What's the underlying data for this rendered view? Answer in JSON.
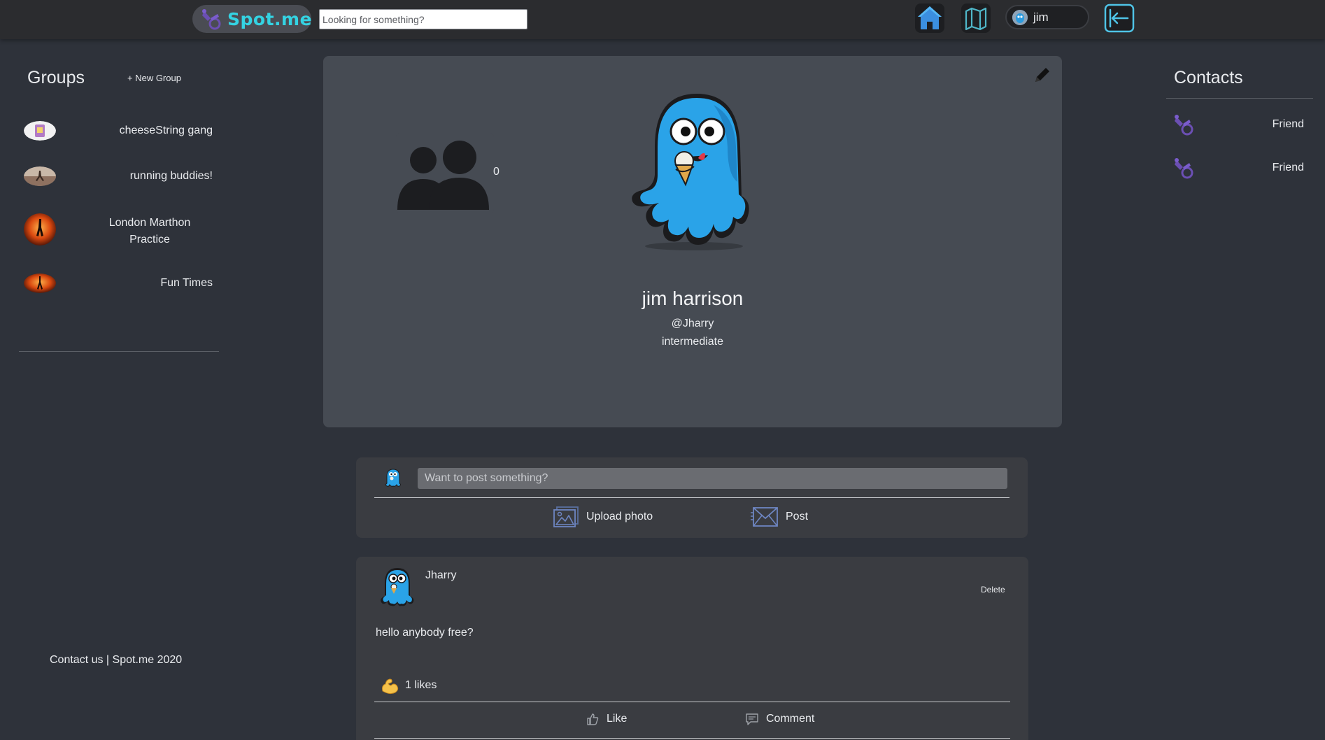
{
  "header": {
    "brand_name": "Spot.me",
    "search_placeholder": "Looking for something?",
    "user_name": "jim",
    "icons": [
      "home-icon",
      "map-icon",
      "logout-icon"
    ],
    "accent_color": "#34d3e3"
  },
  "groups": {
    "title": "Groups",
    "new_group_label": "+ New Group",
    "items": [
      {
        "label": "cheeseString gang"
      },
      {
        "label": "running buddies!"
      },
      {
        "label": "London Marthon Practice"
      },
      {
        "label": "Fun Times"
      }
    ]
  },
  "footer": {
    "text": "Contact us | Spot.me 2020"
  },
  "profile": {
    "followers_count": "0",
    "name": "jim harrison",
    "handle": "@Jharry",
    "level": "intermediate"
  },
  "composer": {
    "placeholder": "Want to post something?",
    "upload_label": "Upload photo",
    "post_label": "Post"
  },
  "post": {
    "author": "Jharry",
    "delete_label": "Delete",
    "body": "hello anybody free?",
    "likes_text": "1 likes",
    "like_label": "Like",
    "comment_label": "Comment"
  },
  "contacts": {
    "title": "Contacts",
    "items": [
      {
        "label": "Friend"
      },
      {
        "label": "Friend"
      }
    ]
  }
}
